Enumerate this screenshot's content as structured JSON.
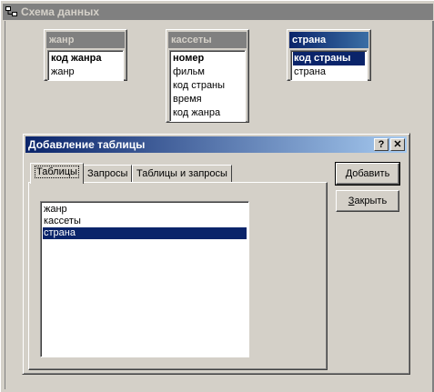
{
  "window": {
    "title": "Схема данных"
  },
  "relation_tables": [
    {
      "title": "жанр",
      "active": false,
      "fields": [
        {
          "name": "код жанра",
          "pk": true,
          "selected": false
        },
        {
          "name": "жанр",
          "pk": false,
          "selected": false
        }
      ]
    },
    {
      "title": "кассеты",
      "active": false,
      "fields": [
        {
          "name": "номер",
          "pk": true,
          "selected": false
        },
        {
          "name": "фильм",
          "pk": false,
          "selected": false
        },
        {
          "name": "код страны",
          "pk": false,
          "selected": false
        },
        {
          "name": "время",
          "pk": false,
          "selected": false
        },
        {
          "name": "код жанра",
          "pk": false,
          "selected": false
        }
      ]
    },
    {
      "title": "страна",
      "active": true,
      "fields": [
        {
          "name": "код страны",
          "pk": true,
          "selected": true
        },
        {
          "name": "страна",
          "pk": false,
          "selected": false
        }
      ]
    }
  ],
  "dialog": {
    "title": "Добавление таблицы",
    "help_label": "?",
    "close_label": "✕",
    "tabs": [
      {
        "label": "Таблицы",
        "active": true
      },
      {
        "label": "Запросы",
        "active": false
      },
      {
        "label": "Таблицы и запросы",
        "active": false
      }
    ],
    "list": [
      {
        "label": "жанр",
        "selected": false
      },
      {
        "label": "кассеты",
        "selected": false
      },
      {
        "label": "страна",
        "selected": true
      }
    ],
    "add_button": {
      "accel": "Д",
      "rest": "обавить"
    },
    "close_button": {
      "accel": "З",
      "rest": "акрыть"
    }
  },
  "colors": {
    "active_title": "#0a246a",
    "inactive_title": "#808080",
    "face": "#d4d0c8",
    "selection": "#0a246a"
  }
}
